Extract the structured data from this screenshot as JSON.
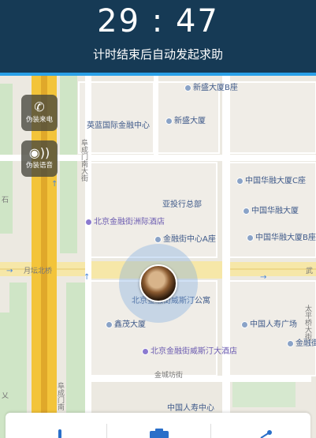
{
  "header": {
    "timer": "29 : 47",
    "subtitle": "计时结束后自动发起求助"
  },
  "fake_buttons": [
    {
      "label": "伪装来电",
      "icon": "phone-icon"
    },
    {
      "label": "伪装语音",
      "icon": "voice-icon"
    }
  ],
  "map": {
    "pois": [
      {
        "name": "新盛大厦B座",
        "style": "blue"
      },
      {
        "name": "英蓝国际金融中心",
        "style": "blue"
      },
      {
        "name": "新盛大厦",
        "style": "blue"
      },
      {
        "name": "中国华融大厦C座",
        "style": "blue"
      },
      {
        "name": "亚投行总部",
        "style": "blue"
      },
      {
        "name": "北京金融街洲际酒店",
        "style": "purple"
      },
      {
        "name": "中国华融大厦",
        "style": "blue"
      },
      {
        "name": "金融街中心A座",
        "style": "blue"
      },
      {
        "name": "中国华融大厦B座",
        "style": "blue"
      },
      {
        "name": "北京金融街威斯汀公寓",
        "style": "blue"
      },
      {
        "name": "鑫茂大厦",
        "style": "blue"
      },
      {
        "name": "中国人寿广场",
        "style": "blue"
      },
      {
        "name": "北京金融街威斯汀大酒店",
        "style": "purple"
      },
      {
        "name": "金融街",
        "style": "blue"
      },
      {
        "name": "中国人寿中心",
        "style": "blue"
      }
    ],
    "streets": {
      "bridge": "月坛北桥",
      "wu": "武",
      "alley": "金城坊街",
      "vert1": "阜成门南大街",
      "vert2": "阜成门南",
      "vert3": "太平桥大街",
      "left_char": "石",
      "left_char2": "乂"
    }
  },
  "bottom_bar": {
    "items": [
      "thermometer-icon",
      "camera-icon",
      "share-icon"
    ]
  }
}
